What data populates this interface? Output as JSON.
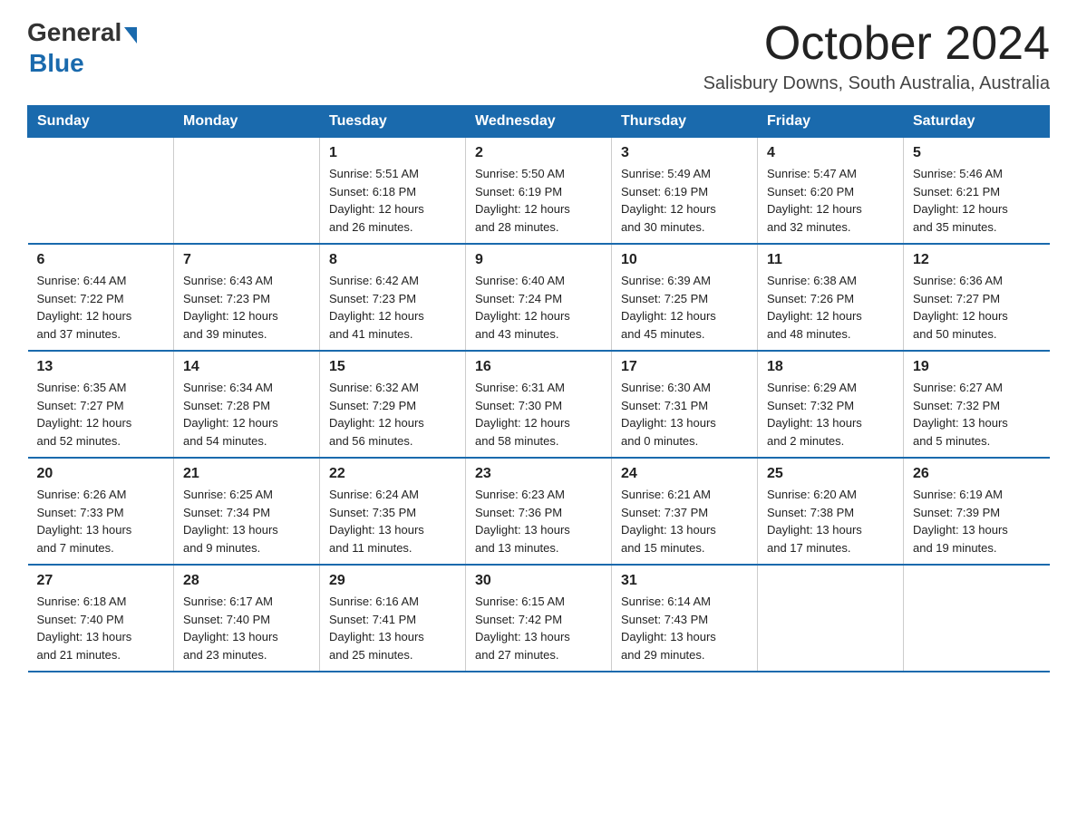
{
  "logo": {
    "general": "General",
    "blue": "Blue"
  },
  "title": "October 2024",
  "subtitle": "Salisbury Downs, South Australia, Australia",
  "weekdays": [
    "Sunday",
    "Monday",
    "Tuesday",
    "Wednesday",
    "Thursday",
    "Friday",
    "Saturday"
  ],
  "weeks": [
    [
      {
        "day": "",
        "info": ""
      },
      {
        "day": "",
        "info": ""
      },
      {
        "day": "1",
        "info": "Sunrise: 5:51 AM\nSunset: 6:18 PM\nDaylight: 12 hours\nand 26 minutes."
      },
      {
        "day": "2",
        "info": "Sunrise: 5:50 AM\nSunset: 6:19 PM\nDaylight: 12 hours\nand 28 minutes."
      },
      {
        "day": "3",
        "info": "Sunrise: 5:49 AM\nSunset: 6:19 PM\nDaylight: 12 hours\nand 30 minutes."
      },
      {
        "day": "4",
        "info": "Sunrise: 5:47 AM\nSunset: 6:20 PM\nDaylight: 12 hours\nand 32 minutes."
      },
      {
        "day": "5",
        "info": "Sunrise: 5:46 AM\nSunset: 6:21 PM\nDaylight: 12 hours\nand 35 minutes."
      }
    ],
    [
      {
        "day": "6",
        "info": "Sunrise: 6:44 AM\nSunset: 7:22 PM\nDaylight: 12 hours\nand 37 minutes."
      },
      {
        "day": "7",
        "info": "Sunrise: 6:43 AM\nSunset: 7:23 PM\nDaylight: 12 hours\nand 39 minutes."
      },
      {
        "day": "8",
        "info": "Sunrise: 6:42 AM\nSunset: 7:23 PM\nDaylight: 12 hours\nand 41 minutes."
      },
      {
        "day": "9",
        "info": "Sunrise: 6:40 AM\nSunset: 7:24 PM\nDaylight: 12 hours\nand 43 minutes."
      },
      {
        "day": "10",
        "info": "Sunrise: 6:39 AM\nSunset: 7:25 PM\nDaylight: 12 hours\nand 45 minutes."
      },
      {
        "day": "11",
        "info": "Sunrise: 6:38 AM\nSunset: 7:26 PM\nDaylight: 12 hours\nand 48 minutes."
      },
      {
        "day": "12",
        "info": "Sunrise: 6:36 AM\nSunset: 7:27 PM\nDaylight: 12 hours\nand 50 minutes."
      }
    ],
    [
      {
        "day": "13",
        "info": "Sunrise: 6:35 AM\nSunset: 7:27 PM\nDaylight: 12 hours\nand 52 minutes."
      },
      {
        "day": "14",
        "info": "Sunrise: 6:34 AM\nSunset: 7:28 PM\nDaylight: 12 hours\nand 54 minutes."
      },
      {
        "day": "15",
        "info": "Sunrise: 6:32 AM\nSunset: 7:29 PM\nDaylight: 12 hours\nand 56 minutes."
      },
      {
        "day": "16",
        "info": "Sunrise: 6:31 AM\nSunset: 7:30 PM\nDaylight: 12 hours\nand 58 minutes."
      },
      {
        "day": "17",
        "info": "Sunrise: 6:30 AM\nSunset: 7:31 PM\nDaylight: 13 hours\nand 0 minutes."
      },
      {
        "day": "18",
        "info": "Sunrise: 6:29 AM\nSunset: 7:32 PM\nDaylight: 13 hours\nand 2 minutes."
      },
      {
        "day": "19",
        "info": "Sunrise: 6:27 AM\nSunset: 7:32 PM\nDaylight: 13 hours\nand 5 minutes."
      }
    ],
    [
      {
        "day": "20",
        "info": "Sunrise: 6:26 AM\nSunset: 7:33 PM\nDaylight: 13 hours\nand 7 minutes."
      },
      {
        "day": "21",
        "info": "Sunrise: 6:25 AM\nSunset: 7:34 PM\nDaylight: 13 hours\nand 9 minutes."
      },
      {
        "day": "22",
        "info": "Sunrise: 6:24 AM\nSunset: 7:35 PM\nDaylight: 13 hours\nand 11 minutes."
      },
      {
        "day": "23",
        "info": "Sunrise: 6:23 AM\nSunset: 7:36 PM\nDaylight: 13 hours\nand 13 minutes."
      },
      {
        "day": "24",
        "info": "Sunrise: 6:21 AM\nSunset: 7:37 PM\nDaylight: 13 hours\nand 15 minutes."
      },
      {
        "day": "25",
        "info": "Sunrise: 6:20 AM\nSunset: 7:38 PM\nDaylight: 13 hours\nand 17 minutes."
      },
      {
        "day": "26",
        "info": "Sunrise: 6:19 AM\nSunset: 7:39 PM\nDaylight: 13 hours\nand 19 minutes."
      }
    ],
    [
      {
        "day": "27",
        "info": "Sunrise: 6:18 AM\nSunset: 7:40 PM\nDaylight: 13 hours\nand 21 minutes."
      },
      {
        "day": "28",
        "info": "Sunrise: 6:17 AM\nSunset: 7:40 PM\nDaylight: 13 hours\nand 23 minutes."
      },
      {
        "day": "29",
        "info": "Sunrise: 6:16 AM\nSunset: 7:41 PM\nDaylight: 13 hours\nand 25 minutes."
      },
      {
        "day": "30",
        "info": "Sunrise: 6:15 AM\nSunset: 7:42 PM\nDaylight: 13 hours\nand 27 minutes."
      },
      {
        "day": "31",
        "info": "Sunrise: 6:14 AM\nSunset: 7:43 PM\nDaylight: 13 hours\nand 29 minutes."
      },
      {
        "day": "",
        "info": ""
      },
      {
        "day": "",
        "info": ""
      }
    ]
  ]
}
